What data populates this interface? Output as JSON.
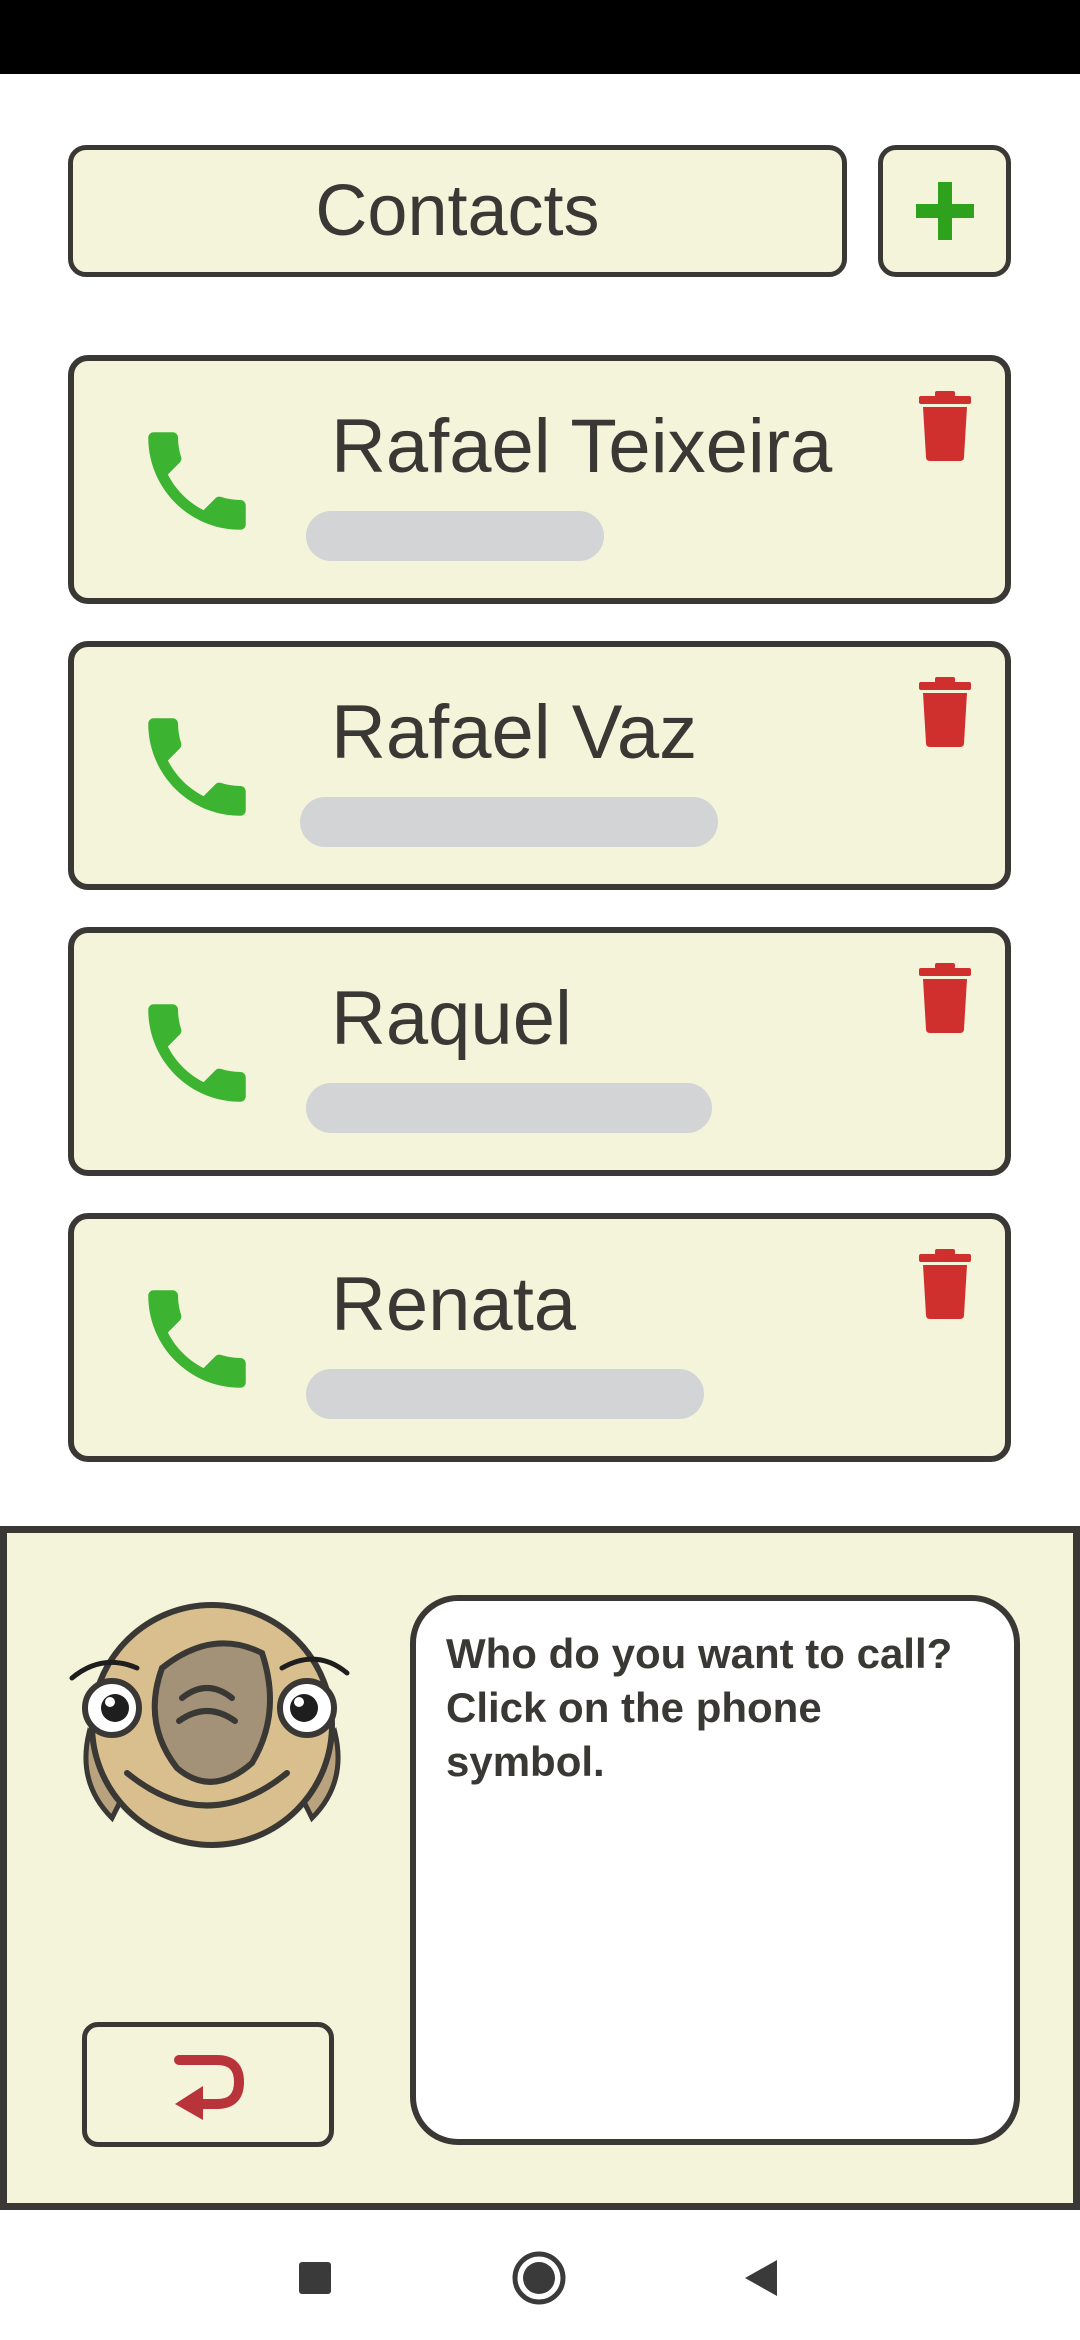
{
  "header": {
    "title": "Contacts",
    "add_icon": "plus-icon"
  },
  "contacts": [
    {
      "name": "Rafael Teixeira",
      "number": "redacted"
    },
    {
      "name": "Rafael Vaz",
      "number": "redacted"
    },
    {
      "name": "Raquel",
      "number": "redacted"
    },
    {
      "name": "Renata",
      "number": "redacted"
    }
  ],
  "assistant": {
    "message": "Who do you want to call? Click on the phone symbol.",
    "back_icon": "return-arrow-icon",
    "mascot": "sloth-mascot"
  },
  "nav": {
    "items": [
      "recents-square-icon",
      "home-circle-icon",
      "back-triangle-icon"
    ]
  },
  "colors": {
    "card_background": "#f4f4da",
    "border": "#3a3835",
    "phone_green": "#3cb431",
    "delete_red": "#cf2f2d",
    "add_green": "#2ea21d",
    "back_red": "#b8333a",
    "redaction": "#d3d4d6"
  }
}
